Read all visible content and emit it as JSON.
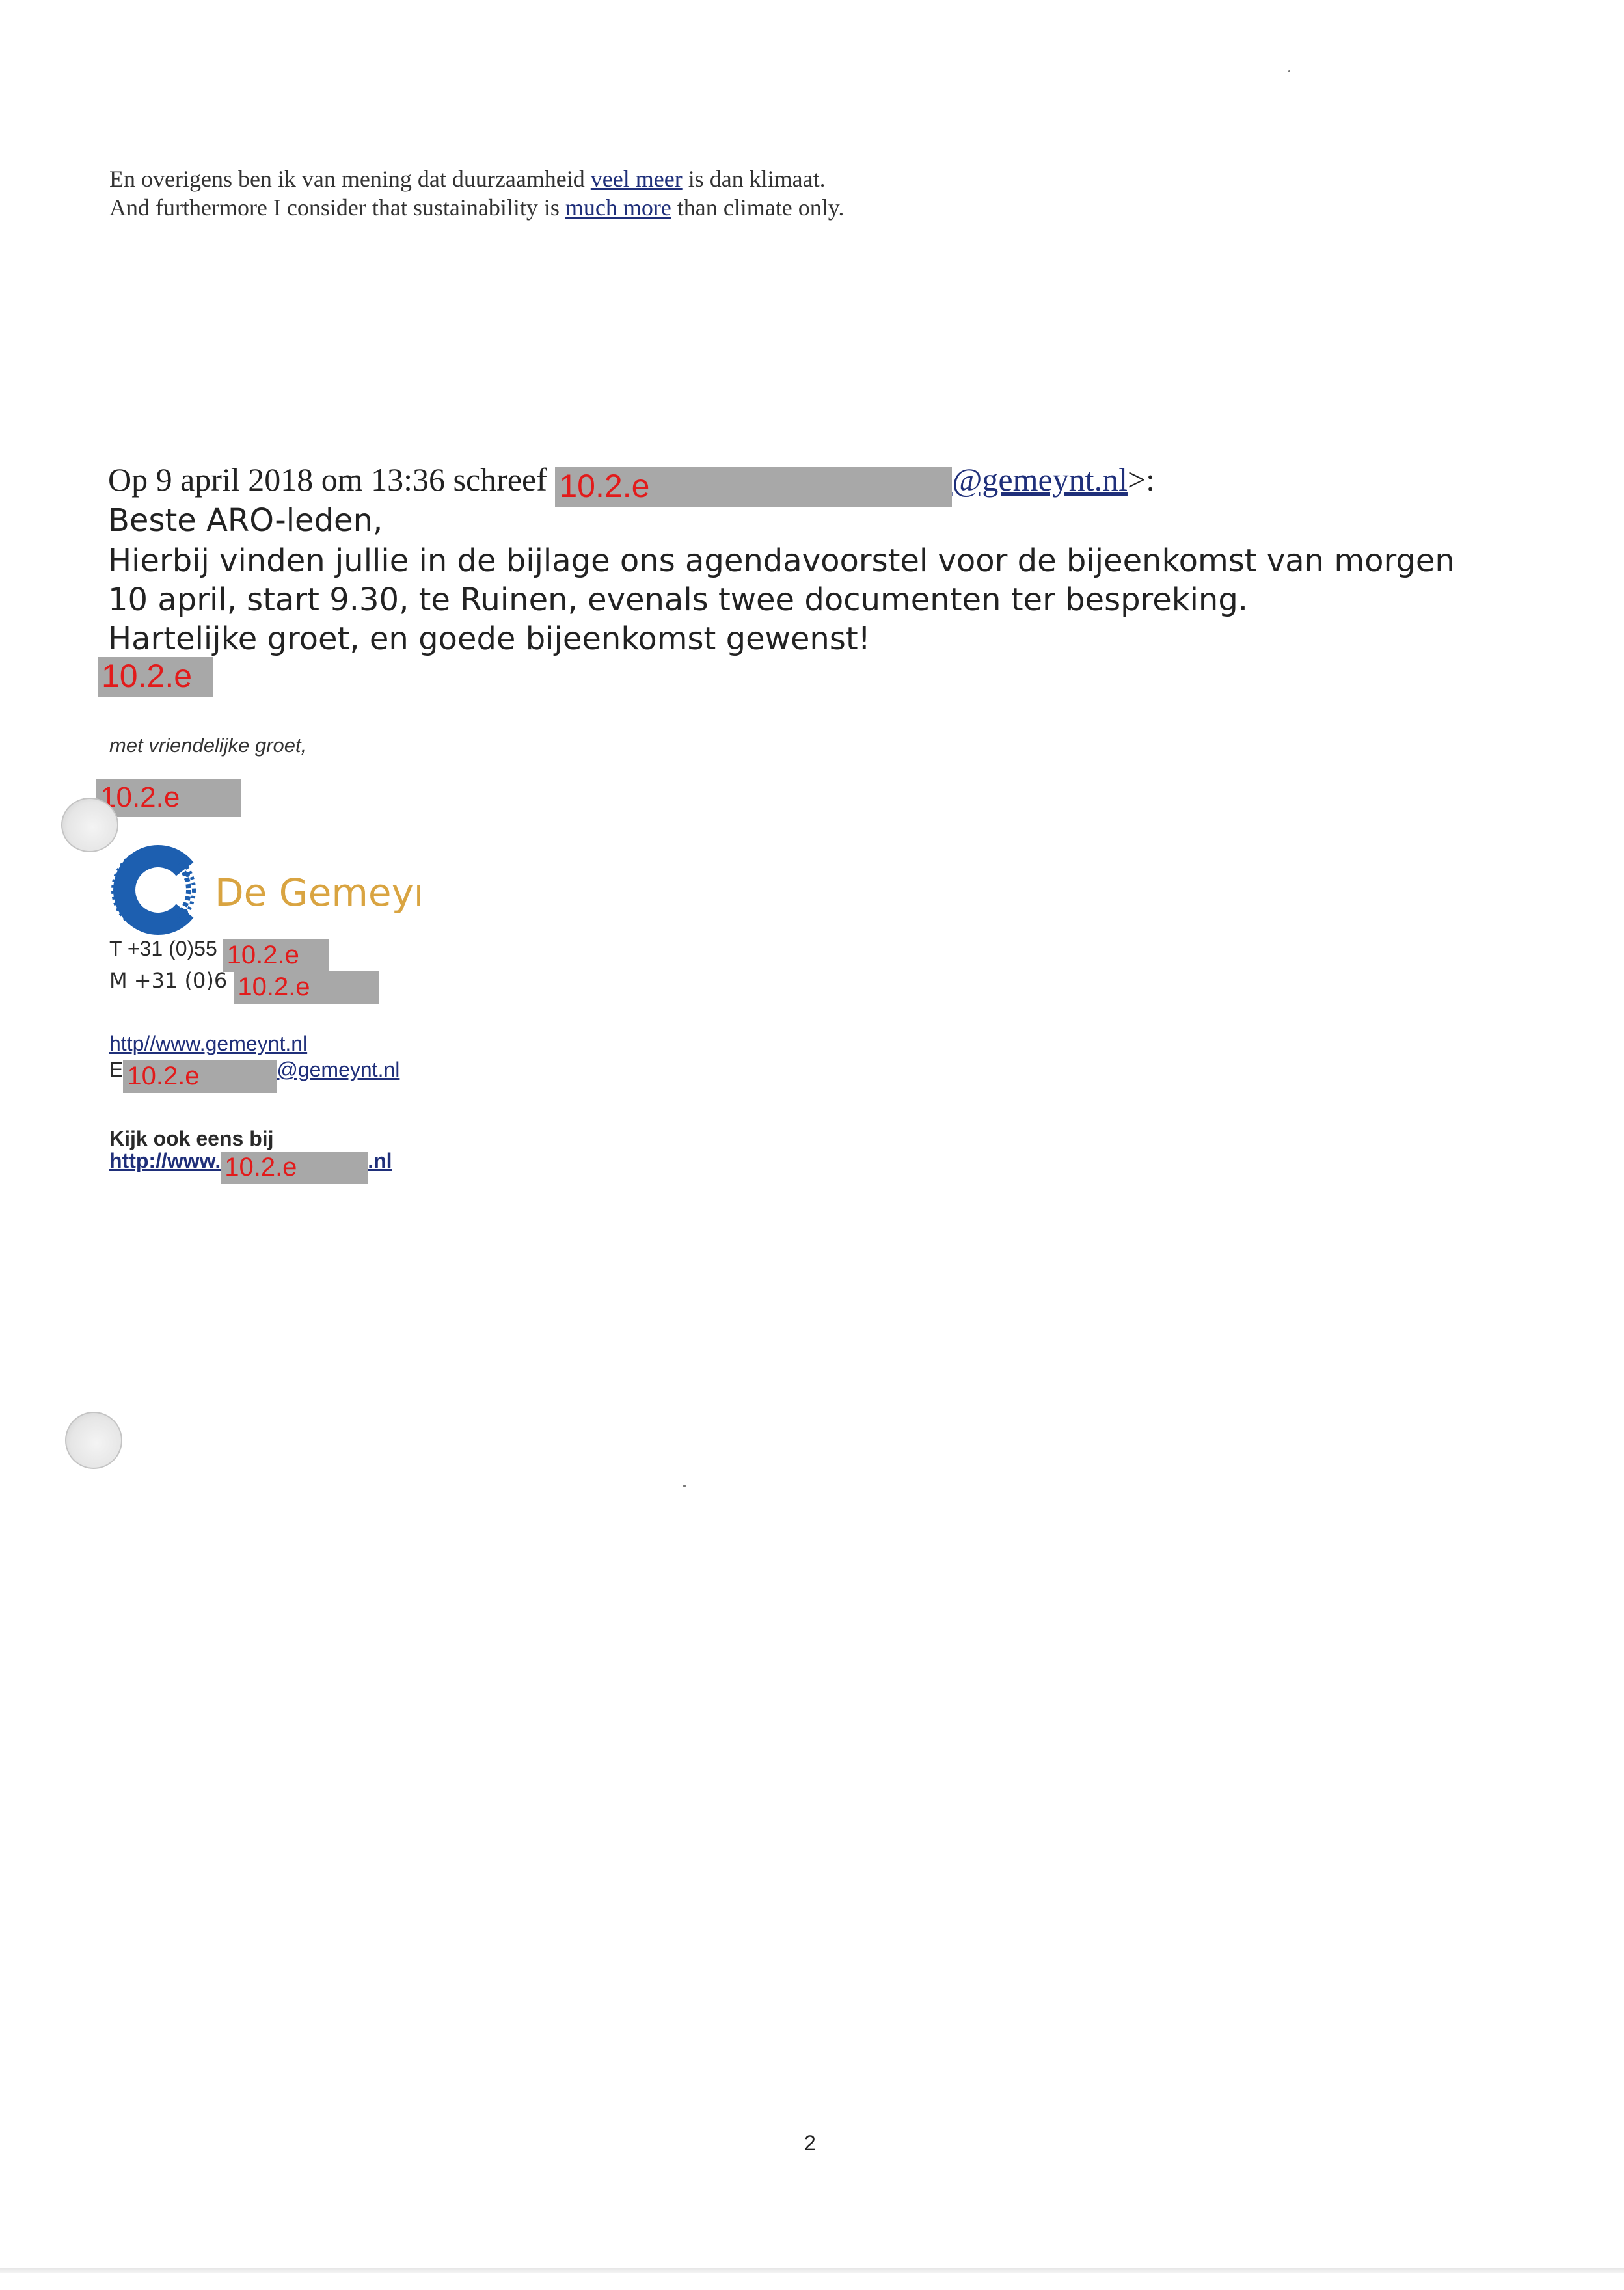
{
  "top_note": {
    "nl_prefix": "En overigens ben ik van mening dat duurzaamheid ",
    "nl_link": "veel meer",
    "nl_suffix": " is dan klimaat.",
    "en_prefix": "And furthermore I consider that sustainability is ",
    "en_link": "much more",
    "en_suffix": " than climate only."
  },
  "quoted_header": {
    "prefix": "Op 9 april 2018 om 13:36 schreef ",
    "redaction_label": "10.2.e",
    "email_domain": "@gemeynt.nl",
    "suffix": ">:"
  },
  "message": {
    "greeting": "Beste ARO-leden,",
    "line1": "Hierbij vinden jullie in de bijlage ons agendavoorstel voor de bijeenkomst van morgen",
    "line2": "10 april, start 9.30, te Ruinen, evenals twee documenten ter bespreking.",
    "line3": "Hartelijke groet, en goede bijeenkomst gewenst!",
    "signature_redaction": "10.2.e"
  },
  "signature": {
    "closing": "met vriendelijke groet,",
    "name_redaction": "10.2.e",
    "logo_text": "De Gemeynt",
    "phone_prefix": "T +31 (0)55 ",
    "phone_redaction": "10.2.e",
    "mobile_prefix": "M +31 (0)6 ",
    "mobile_redaction": "10.2.e",
    "website": "http//www.gemeynt.nl",
    "email_prefix": "E",
    "email_redaction": "10.2.e",
    "email_suffix": "@gemeynt.nl",
    "see_also": "Kijk ook eens bij",
    "see_also_link_prefix": "http://www.",
    "see_also_redaction": "10.2.e",
    "see_also_link_suffix": ".nl"
  },
  "footer": {
    "page_number": "2"
  },
  "colors": {
    "link": "#1f2f7a",
    "redaction_fill": "#a8a8a8",
    "redaction_text": "#e21b1b",
    "logo_blue": "#1d5fb0",
    "logo_text": "#d9a441"
  }
}
